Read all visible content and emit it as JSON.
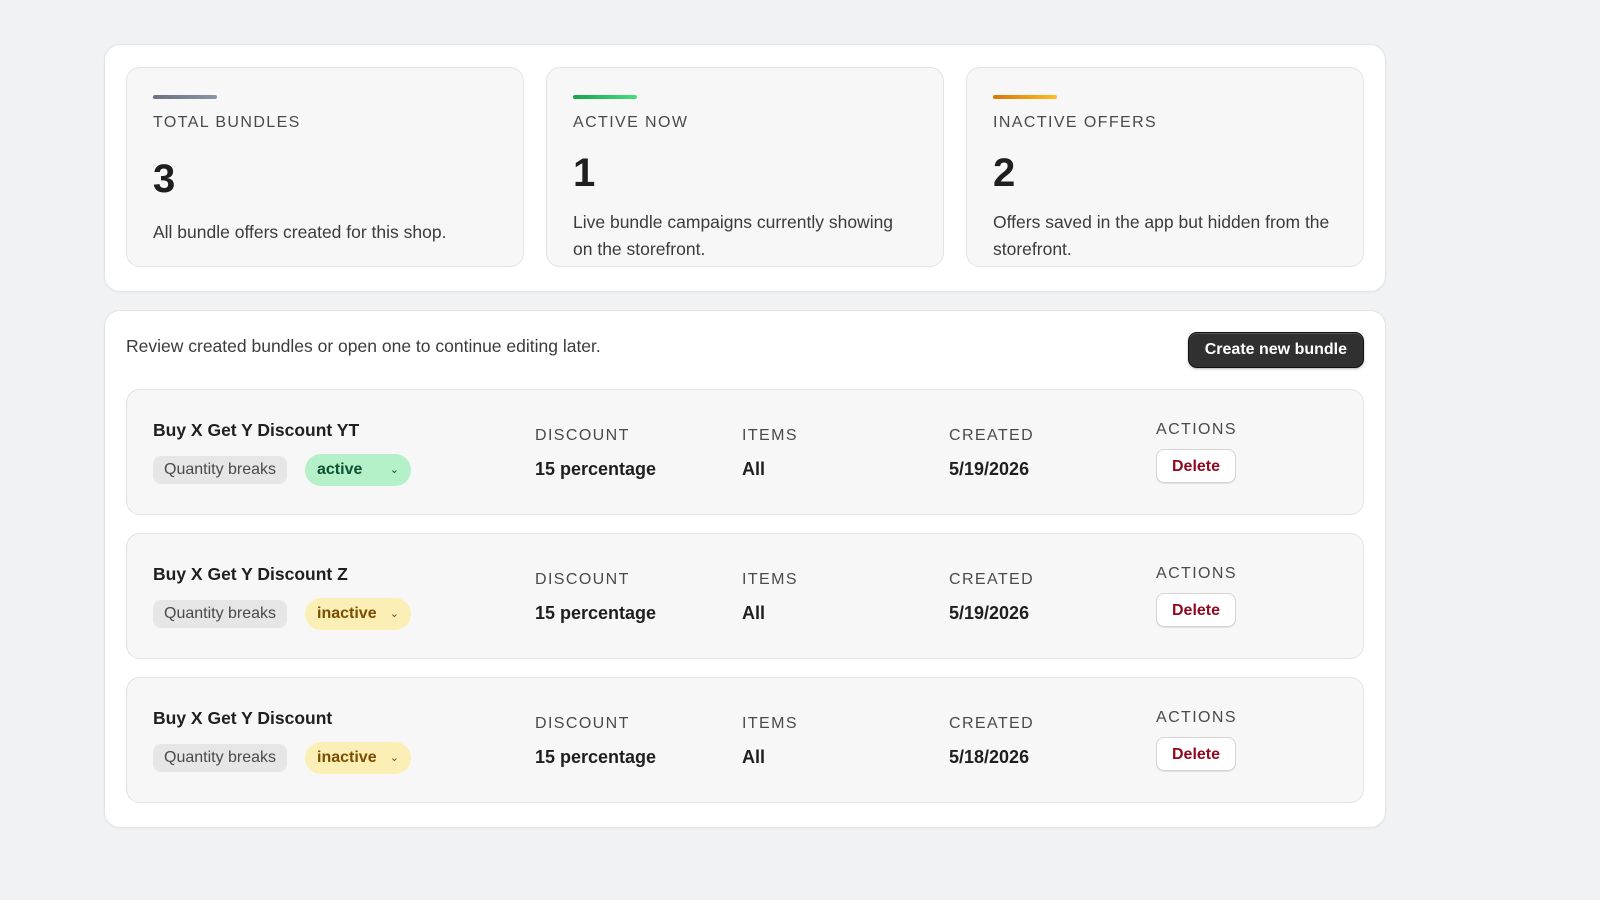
{
  "stats": [
    {
      "label": "TOTAL BUNDLES",
      "value": "3",
      "description": "All bundle offers created for this shop.",
      "accent": [
        "#6b7280",
        "#8a94a6"
      ]
    },
    {
      "label": "ACTIVE NOW",
      "value": "1",
      "description": "Live bundle campaigns currently showing on the storefront.",
      "accent": [
        "#16a34a",
        "#4ade80"
      ]
    },
    {
      "label": "INACTIVE OFFERS",
      "value": "2",
      "description": "Offers saved in the app but hidden from the storefront.",
      "accent": [
        "#d97706",
        "#fbbf24"
      ]
    }
  ],
  "list": {
    "intro": "Review created bundles or open one to continue editing later.",
    "create_label": "Create new bundle",
    "columns": {
      "discount": "DISCOUNT",
      "items": "ITEMS",
      "created": "CREATED",
      "actions": "ACTIONS"
    },
    "bundles": [
      {
        "name": "Buy X Get Y Discount YT",
        "type": "Quantity breaks",
        "status": "active",
        "discount": "15 percentage",
        "items": "All",
        "created": "5/19/2026",
        "delete_label": "Delete"
      },
      {
        "name": "Buy X Get Y Discount Z",
        "type": "Quantity breaks",
        "status": "inactive",
        "discount": "15 percentage",
        "items": "All",
        "created": "5/19/2026",
        "delete_label": "Delete"
      },
      {
        "name": "Buy X Get Y Discount",
        "type": "Quantity breaks",
        "status": "inactive",
        "discount": "15 percentage",
        "items": "All",
        "created": "5/18/2026",
        "delete_label": "Delete"
      }
    ]
  },
  "icons": {
    "status_dropdown": "chevron-down-icon"
  },
  "colors": {
    "active_status_bg": "#b4f0c8",
    "inactive_status_bg": "#fbefb5",
    "delete_text": "#8e0b21",
    "primary_button": "#303030"
  }
}
